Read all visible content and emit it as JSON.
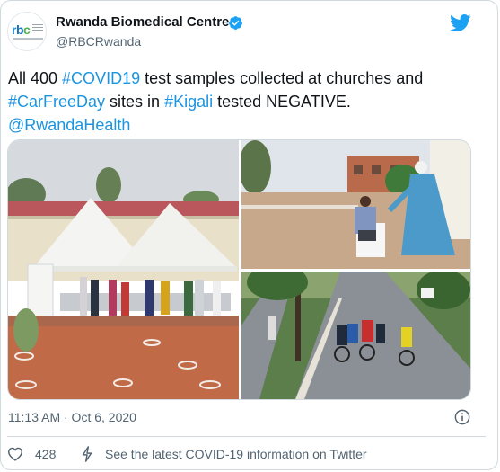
{
  "account": {
    "name": "Rwanda Biomedical Centre",
    "handle": "@RBCRwanda",
    "avatar_text": "rbc"
  },
  "tweet": {
    "segments": [
      {
        "text": "All 400 ",
        "link": false
      },
      {
        "text": "#COVID19",
        "link": true
      },
      {
        "text": " test samples collected at churches and ",
        "link": false
      },
      {
        "text": "#CarFreeDay",
        "link": true
      },
      {
        "text": " sites in ",
        "link": false
      },
      {
        "text": "#Kigali",
        "link": true
      },
      {
        "text": " tested NEGATIVE.",
        "link": false
      },
      {
        "text": "@RwandaHealth",
        "link": true
      }
    ]
  },
  "timestamp": "11:13 AM · Oct 6, 2020",
  "actions": {
    "like_count": "428",
    "covid_info": "See the latest COVID-19 information on Twitter"
  },
  "colors": {
    "link": "#1b95e0",
    "twitter_blue": "#1da1f2",
    "muted": "#536471",
    "border": "#cfd9de"
  },
  "icons": [
    "verified-badge-icon",
    "twitter-bird-icon",
    "info-icon",
    "heart-icon",
    "bolt-icon"
  ]
}
